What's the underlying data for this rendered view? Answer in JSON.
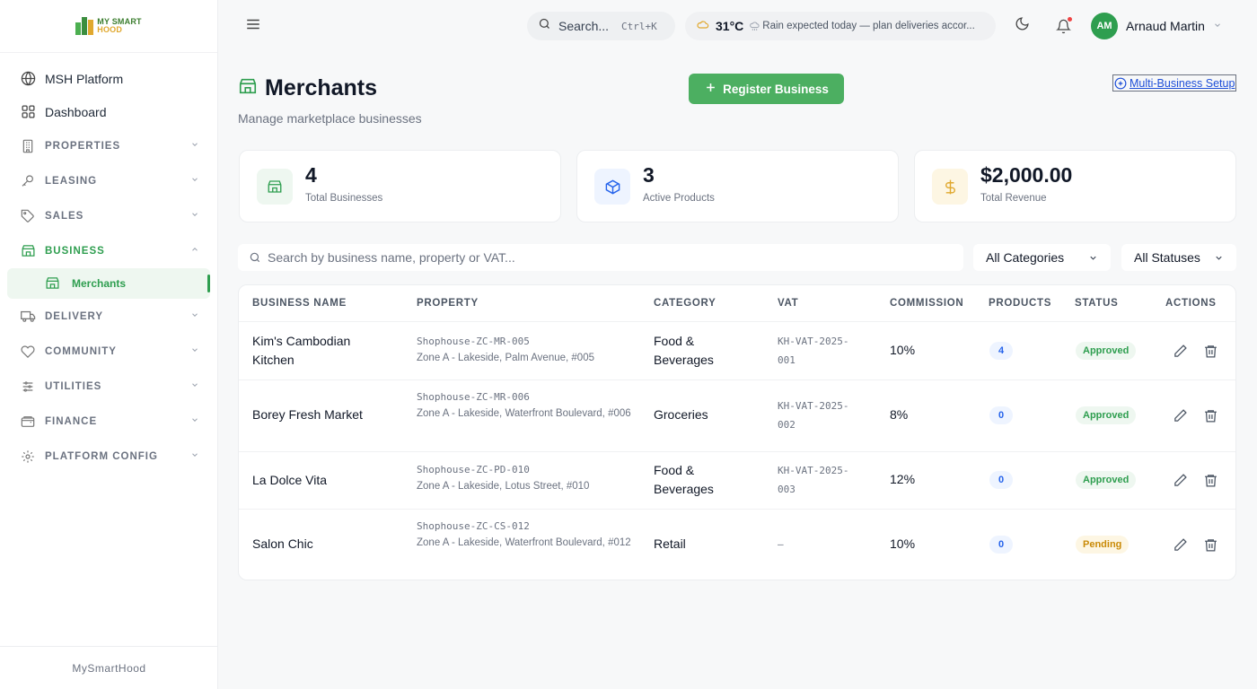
{
  "brand": {
    "line1": "MY SMART",
    "line2": "HOOD"
  },
  "sidebar": {
    "items": [
      {
        "label": "MSH Platform"
      },
      {
        "label": "Dashboard"
      },
      {
        "label": "PROPERTIES"
      },
      {
        "label": "LEASING"
      },
      {
        "label": "SALES"
      },
      {
        "label": "BUSINESS"
      },
      {
        "label": "Merchants"
      },
      {
        "label": "DELIVERY"
      },
      {
        "label": "COMMUNITY"
      },
      {
        "label": "UTILITIES"
      },
      {
        "label": "FINANCE"
      },
      {
        "label": "PLATFORM CONFIG"
      }
    ],
    "footer": "MySmartHood"
  },
  "topbar": {
    "search_label": "Search...",
    "search_shortcut": "Ctrl+K",
    "temperature": "31°C",
    "weather_message": "Rain expected today — plan deliveries accor...",
    "user_initials": "AM",
    "user_name": "Arnaud Martin"
  },
  "page": {
    "title": "Merchants",
    "subtitle": "Manage marketplace businesses",
    "register_label": "Register Business",
    "multi_label": "Multi-Business Setup"
  },
  "stats": [
    {
      "value": "4",
      "label": "Total Businesses"
    },
    {
      "value": "3",
      "label": "Active Products"
    },
    {
      "value": "$2,000.00",
      "label": "Total Revenue"
    }
  ],
  "filters": {
    "search_placeholder": "Search by business name, property or VAT...",
    "category": "All Categories",
    "status": "All Statuses"
  },
  "table": {
    "headers": [
      "BUSINESS NAME",
      "PROPERTY",
      "CATEGORY",
      "VAT",
      "COMMISSION",
      "PRODUCTS",
      "STATUS",
      "ACTIONS"
    ],
    "rows": [
      {
        "name": "Kim's Cambodian Kitchen",
        "code": "Shophouse-ZC-MR-005",
        "address": "Zone A - Lakeside, Palm Avenue, #005",
        "category": "Food & Beverages",
        "vat": "KH-VAT-2025-001",
        "commission": "10%",
        "products": "4",
        "status": "Approved"
      },
      {
        "name": "Borey Fresh Market",
        "code": "Shophouse-ZC-MR-006",
        "address": "Zone A - Lakeside, Waterfront Boulevard, #006",
        "category": "Groceries",
        "vat": "KH-VAT-2025-002",
        "commission": "8%",
        "products": "0",
        "status": "Approved"
      },
      {
        "name": "La Dolce Vita",
        "code": "Shophouse-ZC-PD-010",
        "address": "Zone A - Lakeside, Lotus Street, #010",
        "category": "Food & Beverages",
        "vat": "KH-VAT-2025-003",
        "commission": "12%",
        "products": "0",
        "status": "Approved"
      },
      {
        "name": "Salon Chic",
        "code": "Shophouse-ZC-CS-012",
        "address": "Zone A - Lakeside, Waterfront Boulevard, #012",
        "category": "Retail",
        "vat": "–",
        "commission": "10%",
        "products": "0",
        "status": "Pending"
      }
    ]
  }
}
